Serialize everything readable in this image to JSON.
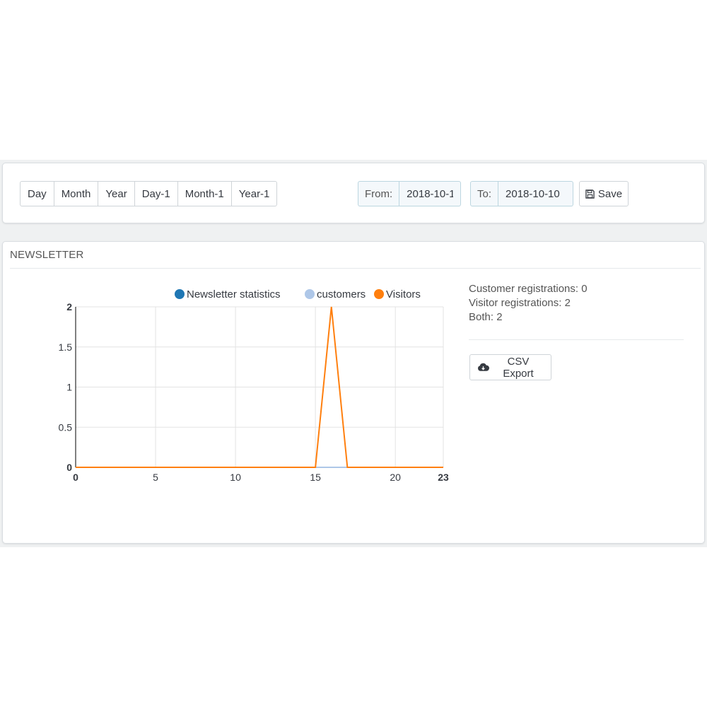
{
  "filters": {
    "range_buttons": [
      "Day",
      "Month",
      "Year",
      "Day-1",
      "Month-1",
      "Year-1"
    ],
    "from_label": "From:",
    "from_value": "2018-10-1",
    "to_label": "To:",
    "to_value": "2018-10-10",
    "save_label": "Save"
  },
  "newsletter": {
    "title": "NEWSLETTER",
    "stats": {
      "customer_registrations": "Customer registrations: 0",
      "visitor_registrations": "Visitor registrations: 2",
      "both": "Both: 2"
    },
    "csv_export_label": "CSV Export"
  },
  "chart_data": {
    "type": "line",
    "x": [
      0,
      1,
      2,
      3,
      4,
      5,
      6,
      7,
      8,
      9,
      10,
      11,
      12,
      13,
      14,
      15,
      16,
      17,
      18,
      19,
      20,
      21,
      22,
      23
    ],
    "xlim": [
      0,
      23
    ],
    "ylim": [
      0,
      2
    ],
    "x_ticks": [
      0,
      5,
      10,
      15,
      20,
      23
    ],
    "y_ticks": [
      0,
      0.5,
      1,
      1.5,
      2
    ],
    "x_tick_labels": [
      "0",
      "5",
      "10",
      "15",
      "20",
      "23"
    ],
    "y_tick_labels": [
      "0",
      "0.5",
      "1",
      "1.5",
      "2"
    ],
    "grid": true,
    "legend_position": "top",
    "series": [
      {
        "name": "Newsletter statistics",
        "color": "#1f77b4",
        "values": [
          0,
          0,
          0,
          0,
          0,
          0,
          0,
          0,
          0,
          0,
          0,
          0,
          0,
          0,
          0,
          0,
          0,
          0,
          0,
          0,
          0,
          0,
          0,
          0
        ]
      },
      {
        "name": "customers",
        "color": "#aec7e8",
        "values": [
          0,
          0,
          0,
          0,
          0,
          0,
          0,
          0,
          0,
          0,
          0,
          0,
          0,
          0,
          0,
          0,
          0,
          0,
          0,
          0,
          0,
          0,
          0,
          0
        ]
      },
      {
        "name": "Visitors",
        "color": "#ff7f0e",
        "values": [
          0,
          0,
          0,
          0,
          0,
          0,
          0,
          0,
          0,
          0,
          0,
          0,
          0,
          0,
          0,
          0,
          2,
          0,
          0,
          0,
          0,
          0,
          0,
          0
        ]
      }
    ]
  },
  "colors": {
    "accent_blue": "#1f77b4",
    "accent_light_blue": "#aec7e8",
    "accent_orange": "#ff7f0e"
  },
  "icons": {
    "save": "floppy-disk-icon",
    "csv": "cloud-download-icon"
  }
}
